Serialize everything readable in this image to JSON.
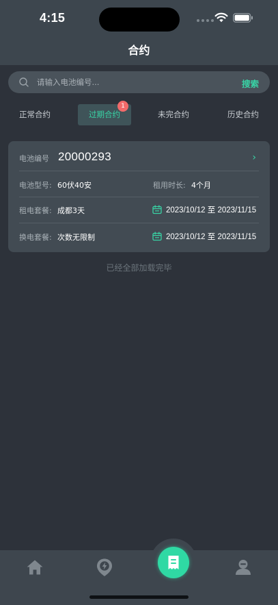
{
  "status_bar": {
    "time": "4:15"
  },
  "nav": {
    "title": "合约"
  },
  "search": {
    "placeholder": "请输入电池编号...",
    "button": "搜索"
  },
  "tabs": [
    {
      "label": "正常合约",
      "active": false
    },
    {
      "label": "过期合约",
      "active": true,
      "badge": "1"
    },
    {
      "label": "未完合约",
      "active": false
    },
    {
      "label": "历史合约",
      "active": false
    }
  ],
  "contract": {
    "battery_id_label": "电池编号",
    "battery_id": "20000293",
    "model_label": "电池型号:",
    "model": "60伏40安",
    "duration_label": "租用时长:",
    "duration": "4个月",
    "rent_label": "租电套餐:",
    "rent_plan": "成都3天",
    "rent_period": "2023/10/12 至 2023/11/15",
    "swap_label": "换电套餐:",
    "swap_plan": "次数无限制",
    "swap_period": "2023/10/12 至 2023/11/15"
  },
  "list_footer": "已经全部加载完毕",
  "colors": {
    "accent": "#39d3a5",
    "badge": "#f16a6a",
    "background": "#2d323a",
    "card": "#424b53"
  },
  "tabbar": {
    "icons": [
      "home-icon",
      "location-bolt-icon",
      "contract-icon",
      "user-icon"
    ],
    "active_index": 2
  }
}
